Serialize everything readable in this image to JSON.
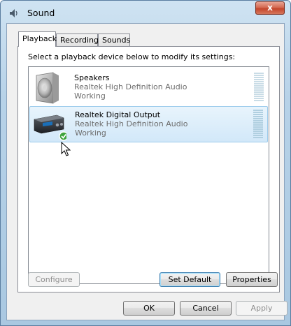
{
  "window": {
    "title": "Sound",
    "close_label": "x"
  },
  "tabs": [
    {
      "label": "Playback",
      "active": true
    },
    {
      "label": "Recording",
      "active": false
    },
    {
      "label": "Sounds",
      "active": false
    }
  ],
  "instruction": "Select a playback device below to modify its settings:",
  "devices": [
    {
      "name": "Speakers",
      "driver": "Realtek High Definition Audio",
      "status": "Working",
      "icon": "speaker-icon",
      "selected": false,
      "default": false
    },
    {
      "name": "Realtek Digital Output",
      "driver": "Realtek High Definition Audio",
      "status": "Working",
      "icon": "digital-output-icon",
      "selected": true,
      "default": true
    }
  ],
  "panel_buttons": {
    "configure": "Configure",
    "set_default": "Set Default",
    "properties": "Properties"
  },
  "dialog_buttons": {
    "ok": "OK",
    "cancel": "Cancel",
    "apply": "Apply"
  },
  "colors": {
    "selection": "#d2e8f9",
    "selection_border": "#9ccbec",
    "close": "#c4452b"
  }
}
